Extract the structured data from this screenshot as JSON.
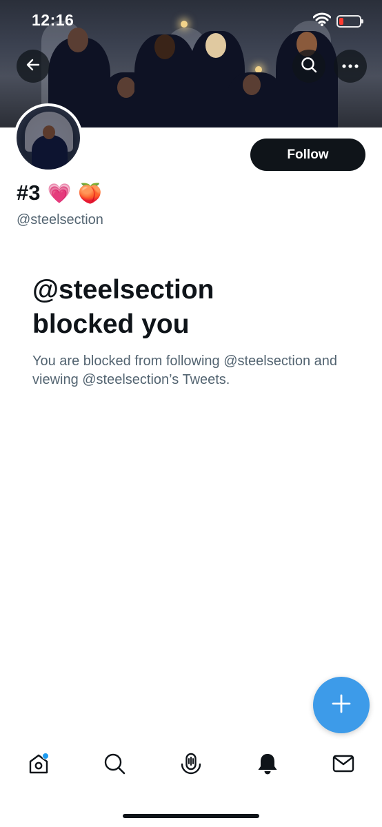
{
  "status_bar": {
    "time": "12:16"
  },
  "profile": {
    "display_name": "#3",
    "name_emojis": [
      "💗",
      "🍑"
    ],
    "handle": "@steelsection",
    "follow_label": "Follow"
  },
  "blocked": {
    "title_line1": "@steelsection",
    "title_line2": "blocked you",
    "description": "You are blocked from following @steelsection and viewing @steelsection’s Tweets."
  },
  "tabs": [
    "home-icon",
    "search-icon",
    "spaces-icon",
    "notifications-icon",
    "messages-icon"
  ],
  "colors": {
    "accent": "#1d9bf0",
    "fab": "#3d9be9",
    "text": "#0f1419",
    "secondary": "#536471",
    "battery_low": "#ff3b30"
  }
}
